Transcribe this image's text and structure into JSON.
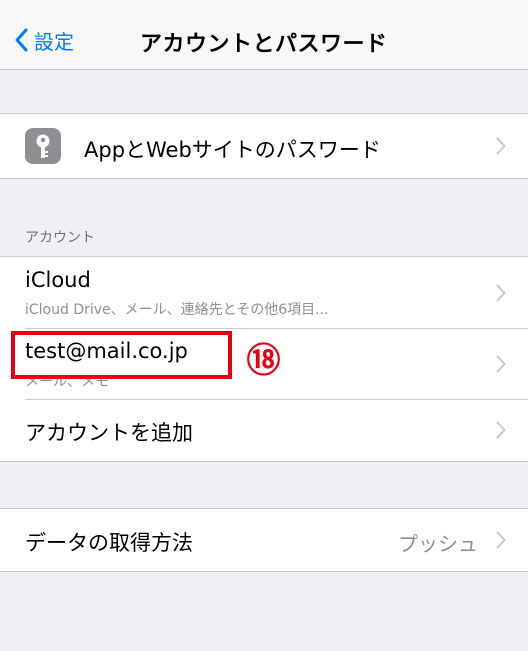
{
  "navbar": {
    "back_label": "設定",
    "title": "アカウントとパスワード"
  },
  "passwords_row": {
    "icon": "key-icon",
    "label": "AppとWebサイトのパスワード"
  },
  "accounts_section": {
    "header": "アカウント",
    "items": [
      {
        "label": "iCloud",
        "subtitle": "iCloud Drive、メール、連絡先とその他6項目..."
      },
      {
        "label": "test@mail.co.jp",
        "subtitle": "メール、メモ"
      },
      {
        "label": "アカウントを追加"
      }
    ]
  },
  "fetch_row": {
    "label": "データの取得方法",
    "value": "プッシュ"
  },
  "annotation": {
    "step_number": "⑱",
    "color": "#e60012"
  },
  "colors": {
    "accent": "#007aff",
    "background": "#efeff4"
  }
}
